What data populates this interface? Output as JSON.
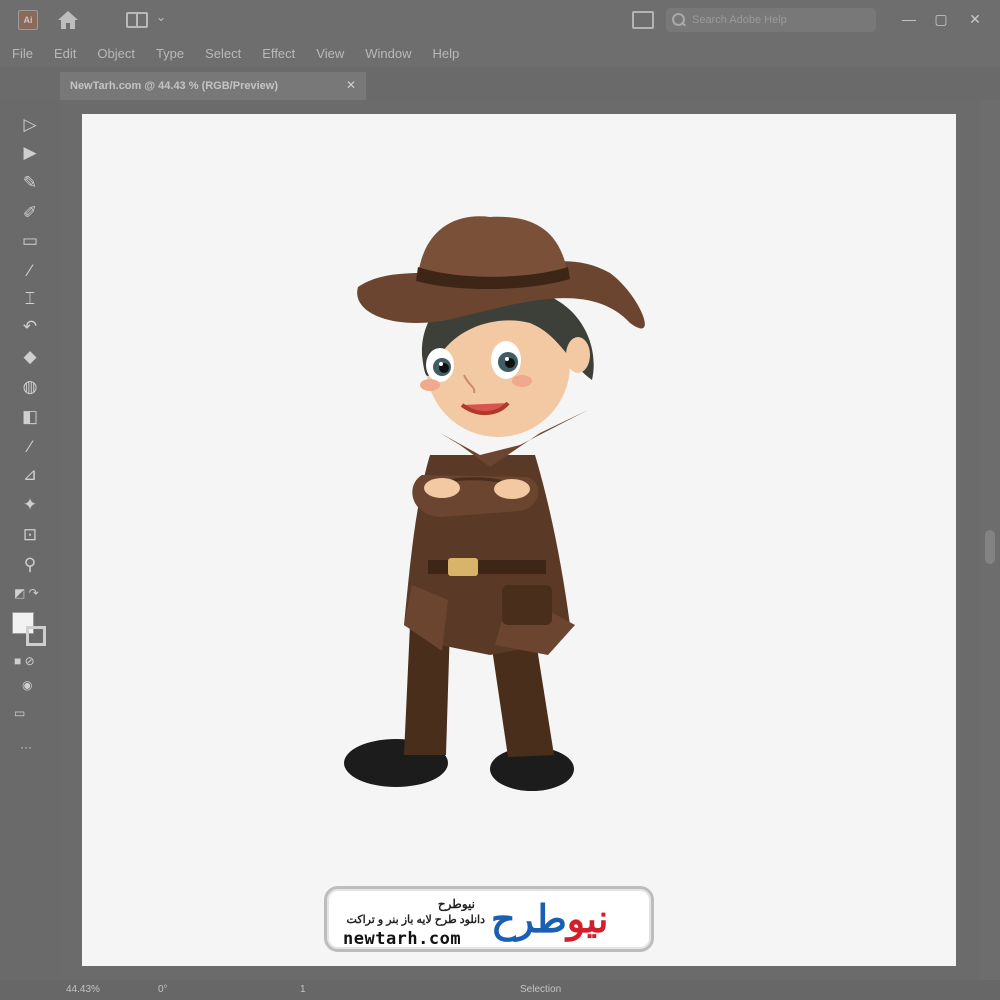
{
  "app": {
    "logo_text": "Ai",
    "search_placeholder": "Search Adobe Help",
    "window_controls": {
      "minimize": "—",
      "maximize": "▢",
      "close": "✕"
    }
  },
  "menu": {
    "items": [
      "File",
      "Edit",
      "Object",
      "Type",
      "Select",
      "Effect",
      "View",
      "Window",
      "Help"
    ]
  },
  "document_tab": {
    "label": "NewTarh.com @ 44.43 % (RGB/Preview)",
    "close": "✕"
  },
  "tools": [
    {
      "icon": "selection-icon",
      "glyph": "▷"
    },
    {
      "icon": "direct-selection-icon",
      "glyph": "▶"
    },
    {
      "icon": "pen-icon",
      "glyph": "✎"
    },
    {
      "icon": "pencil-icon",
      "glyph": "✐"
    },
    {
      "icon": "rectangle-icon",
      "glyph": "▭"
    },
    {
      "icon": "brush-icon",
      "glyph": "⁄"
    },
    {
      "icon": "type-icon",
      "glyph": "⌶"
    },
    {
      "icon": "rotate-icon",
      "glyph": "↶"
    },
    {
      "icon": "eraser-icon",
      "glyph": "◆"
    },
    {
      "icon": "shape-builder-icon",
      "glyph": "◍"
    },
    {
      "icon": "gradient-icon",
      "glyph": "◧"
    },
    {
      "icon": "eyedropper-icon",
      "glyph": "⁄"
    },
    {
      "icon": "blend-icon",
      "glyph": "⊿"
    },
    {
      "icon": "symbol-sprayer-icon",
      "glyph": "✦"
    },
    {
      "icon": "artboard-icon",
      "glyph": "⊡"
    },
    {
      "icon": "zoom-icon",
      "glyph": "⚲"
    }
  ],
  "status": {
    "zoom": "44.43%",
    "rotation": "0°",
    "artboard": "1",
    "mode": "Selection"
  },
  "watermark": {
    "title": "نیوطرح",
    "subtitle": "دانلود طرح لایه باز بنر و تراکت",
    "domain": "newtarh.com",
    "logo_red": "نیو",
    "logo_blue": "طرح"
  },
  "colors": {
    "hat": "#6b4530",
    "coat": "#5a3a26",
    "boots": "#1c1c1c",
    "logo_red": "#d21f2a",
    "logo_blue": "#1a5fb4"
  }
}
